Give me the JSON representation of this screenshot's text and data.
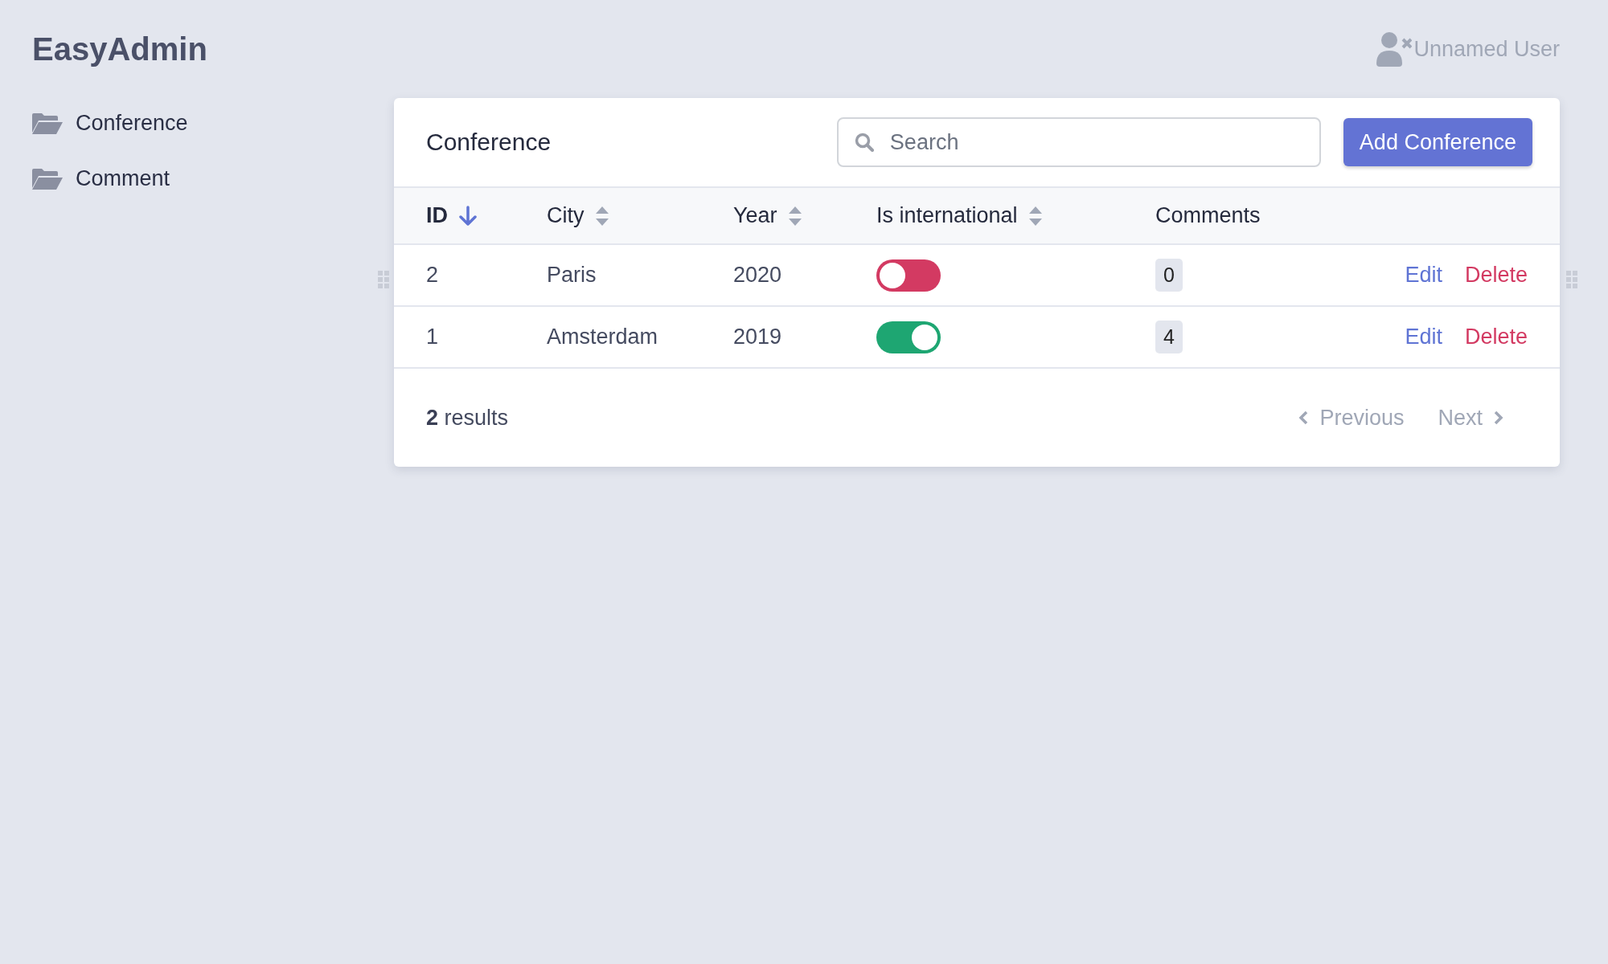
{
  "brand": "EasyAdmin",
  "user": {
    "name": "Unnamed User"
  },
  "sidebar": {
    "items": [
      {
        "label": "Conference",
        "selected": false
      },
      {
        "label": "Comment",
        "selected": false
      }
    ]
  },
  "card": {
    "title": "Conference",
    "search": {
      "placeholder": "Search"
    },
    "add_button": "Add Conference"
  },
  "table": {
    "columns": [
      {
        "label": "ID",
        "sortable": true,
        "sorted": true
      },
      {
        "label": "City",
        "sortable": true,
        "sorted": false
      },
      {
        "label": "Year",
        "sortable": true,
        "sorted": false
      },
      {
        "label": "Is international",
        "sortable": true,
        "sorted": false
      },
      {
        "label": "Comments",
        "sortable": false,
        "sorted": false
      }
    ],
    "rows": [
      {
        "id": "2",
        "city": "Paris",
        "year": "2020",
        "international": false,
        "comments": "0",
        "edit": "Edit",
        "delete": "Delete"
      },
      {
        "id": "1",
        "city": "Amsterdam",
        "year": "2019",
        "international": true,
        "comments": "4",
        "edit": "Edit",
        "delete": "Delete"
      }
    ]
  },
  "footer": {
    "results": "**2** results",
    "previous": {
      "label": "Previous",
      "disabled": true
    },
    "next": {
      "label": "Next",
      "disabled": true
    }
  }
}
